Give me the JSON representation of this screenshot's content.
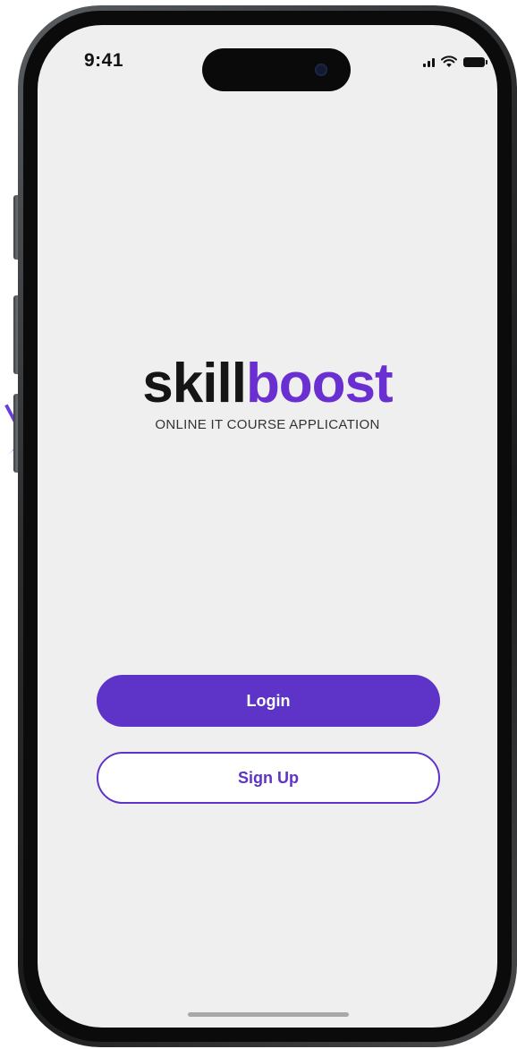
{
  "status_bar": {
    "time": "9:41",
    "icons": [
      "signal-icon",
      "wifi-icon",
      "battery-icon"
    ]
  },
  "logo": {
    "word_dark": "skill",
    "word_purple": "boost",
    "tagline": "ONLINE IT COURSE APPLICATION",
    "colors": {
      "dark": "#151515",
      "purple": "#6a2fd0"
    }
  },
  "actions": {
    "login_label": "Login",
    "signup_label": "Sign Up"
  },
  "theme": {
    "accent": "#5e33c7",
    "screen_background": "#efefef"
  }
}
